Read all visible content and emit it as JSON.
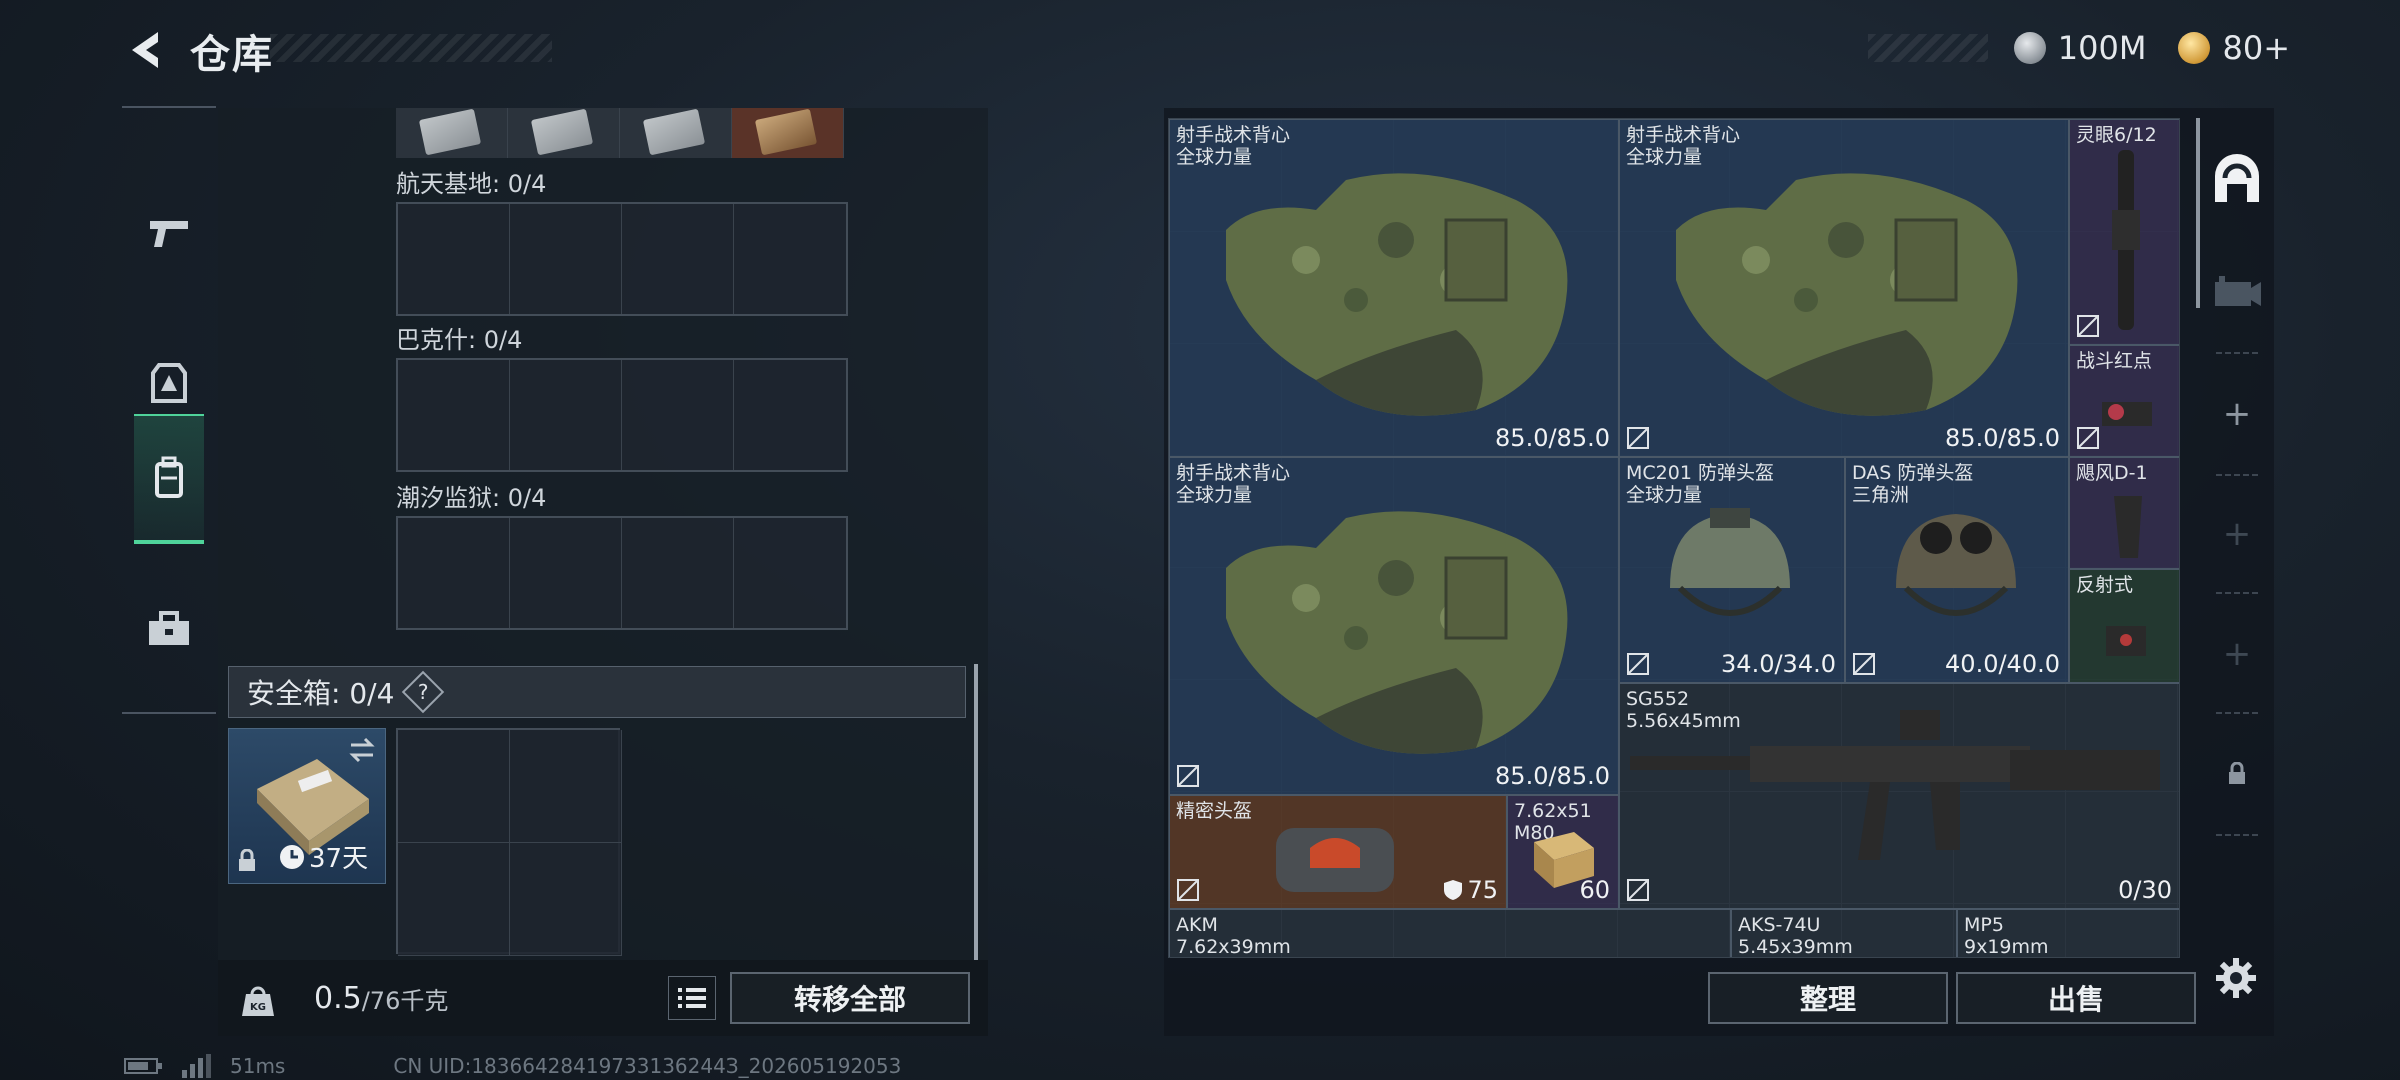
{
  "header": {
    "title": "仓库"
  },
  "currency": [
    {
      "icon": "silver-coin-icon",
      "value": "100M"
    },
    {
      "icon": "gold-coin-icon",
      "value": "80+"
    }
  ],
  "left_nav": [
    {
      "icon": "pistol-icon"
    },
    {
      "icon": "armor-icon"
    },
    {
      "icon": "backpack-icon",
      "active": true
    },
    {
      "icon": "toolbox-icon"
    }
  ],
  "map_slots": [
    {
      "label": "航天基地: 0/4"
    },
    {
      "label": "巴克什: 0/4"
    },
    {
      "label": "潮汐监狱: 0/4"
    }
  ],
  "safe_box": {
    "label": "安全箱: 0/4",
    "help": "?",
    "duration": "37天"
  },
  "weight": {
    "current": "0.5",
    "max": "/76千克"
  },
  "buttons": {
    "transfer_all": "转移全部",
    "sort": "整理",
    "sell": "出售"
  },
  "status": {
    "latency": "51ms",
    "uid": "CN UID:18366428419733136244З_202605192053"
  },
  "stash_items": [
    {
      "name": "射手战术背心\n全球力量",
      "durability": "85.0/85.0"
    },
    {
      "name": "射手战术背心\n全球力量",
      "durability": "85.0/85.0"
    },
    {
      "name": "灵眼6/12"
    },
    {
      "name": "战斗红点"
    },
    {
      "name": "射手战术背心\n全球力量",
      "durability": "85.0/85.0"
    },
    {
      "name": "MC201 防弹头盔\n全球力量",
      "durability": "34.0/34.0"
    },
    {
      "name": "DAS 防弹头盔\n三角洲",
      "durability": "40.0/40.0"
    },
    {
      "name": "飓风D-1"
    },
    {
      "name": "反射式"
    },
    {
      "name": "SG552\n5.56x45mm",
      "durability": "0/30"
    },
    {
      "name": "精密头盔",
      "durability": "75"
    },
    {
      "name": "7.62x51\nM80",
      "durability": "60"
    },
    {
      "name": "AKM\n7.62x39mm"
    },
    {
      "name": "AKS-74U\n5.45x39mm"
    },
    {
      "name": "MP5\n9x19mm"
    }
  ]
}
